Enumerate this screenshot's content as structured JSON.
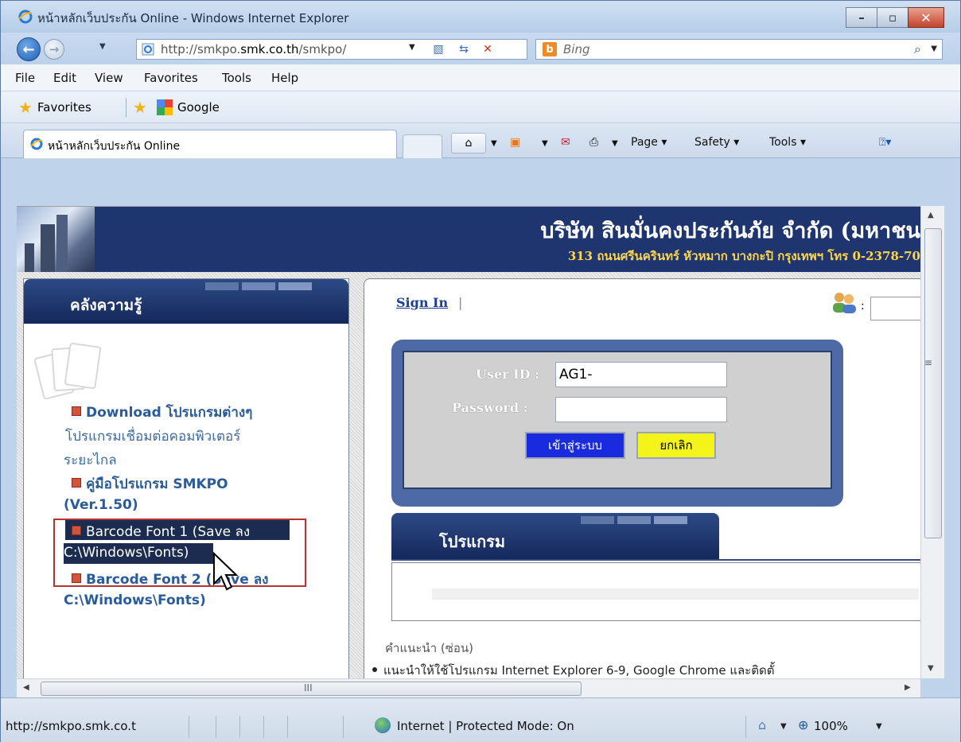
{
  "window": {
    "title": "หน้าหลักเว็บประกัน Online - Windows Internet Explorer"
  },
  "address_bar": {
    "url_prefix": "http://smkpo.",
    "url_domain": "smk.co.th",
    "url_suffix": "/smkpo/",
    "search_placeholder": "Bing",
    "search_engine_initial": "b"
  },
  "menu": {
    "items": [
      "File",
      "Edit",
      "View",
      "Favorites",
      "Tools",
      "Help"
    ]
  },
  "favorites_bar": {
    "favorites_label": "Favorites",
    "google_label": "Google"
  },
  "tab": {
    "title": "หน้าหลักเว็บประกัน Online"
  },
  "command_bar": {
    "page": "Page ▾",
    "safety": "Safety ▾",
    "tools": "Tools ▾"
  },
  "banner": {
    "company": "บริษัท สินมั่นคงประกันภัย จำกัด (มหาชน",
    "address": "313 ถนนศรีนครินทร์ หัวหมาก บางกะปิ กรุงเทพฯ โทร 0-2378-70"
  },
  "left_panel": {
    "title": "คลังความรู้",
    "lines": [
      "Download โปรแกรมต่างๆ",
      "โปรแกรมเชื่อมต่อคอมพิวเตอร์",
      "ระยะไกล",
      "คู่มือโปรแกรม SMKPO",
      "(Ver.1.50)",
      "Barcode Font 1 (Save ลง",
      "C:\\Windows\\Fonts)",
      "Barcode Font 2 (Save ลง",
      "C:\\Windows\\Fonts)"
    ]
  },
  "login": {
    "sign_in": "Sign In",
    "separator": "|",
    "user_label": "User ID :",
    "user_value": "AG1-",
    "password_label": "Password :",
    "submit": "เข้าสู่ระบบ",
    "cancel": "ยกเลิก",
    "colon": ":"
  },
  "program": {
    "title": "โปรแกรม"
  },
  "hint": {
    "title": "คำแนะนำ (ซ่อน)",
    "item": "แนะนำให้ใช้โปรแกรม Internet Explorer 6-9, Google Chrome และติดตั้"
  },
  "status": {
    "url": "http://smkpo.smk.co.t",
    "zone": "Internet | Protected Mode: On",
    "zoom": "100%"
  },
  "scroll": {
    "grip": "≡",
    "hgrip": "III"
  }
}
